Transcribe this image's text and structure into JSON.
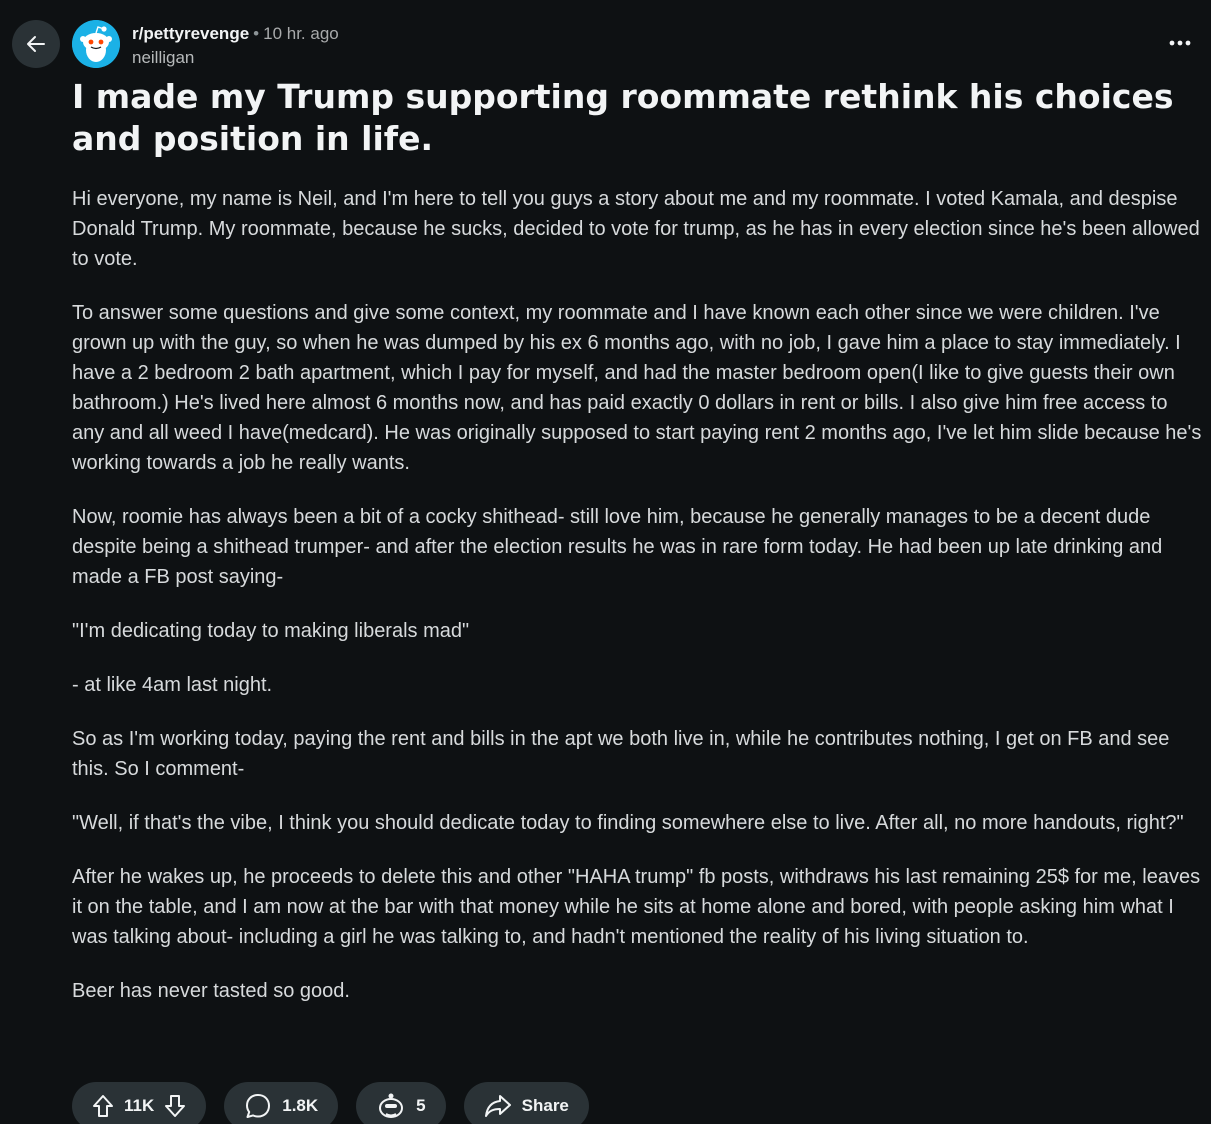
{
  "post": {
    "subreddit": "r/pettyrevenge",
    "separator": "•",
    "time": "10 hr. ago",
    "author": "neilligan",
    "title": "I made my Trump supporting roommate rethink his choices and position in life.",
    "paragraphs": [
      "Hi everyone, my name is Neil, and I'm here to tell you guys a story about me and my roommate. I voted Kamala, and despise Donald Trump. My roommate, because he sucks, decided to vote for trump, as he has in every election since he's been allowed to vote.",
      "To answer some questions and give some context, my roommate and I have known each other since we were children. I've grown up with the guy, so when he was dumped by his ex 6 months ago, with no job, I gave him a place to stay immediately. I have a 2 bedroom 2 bath apartment, which I pay for myself, and had the master bedroom open(I like to give guests their own bathroom.) He's lived here almost 6 months now, and has paid exactly 0 dollars in rent or bills. I also give him free access to any and all weed I have(medcard). He was originally supposed to start paying rent 2 months ago, I've let him slide because he's working towards a job he really wants.",
      "Now, roomie has always been a bit of a cocky shithead- still love him, because he generally manages to be a decent dude despite being a shithead trumper- and after the election results he was in rare form today. He had been up late drinking and made a FB post saying-",
      "\"I'm dedicating today to making liberals mad\"",
      "- at like 4am last night.",
      "So as I'm working today, paying the rent and bills in the apt we both live in, while he contributes nothing, I get on FB and see this. So I comment-",
      "\"Well, if that's the vibe, I think you should dedicate today to finding somewhere else to live. After all, no more handouts, right?\"",
      "After he wakes up, he proceeds to delete this and other \"HAHA trump\" fb posts, withdraws his last remaining 25$ for me, leaves it on the table, and I am now at the bar with that money while he sits at home alone and bored, with people asking him what I was talking about- including a girl he was talking to, and hadn't mentioned the reality of his living situation to.",
      "Beer has never tasted so good."
    ]
  },
  "actions": {
    "votes": "11K",
    "comments": "1.8K",
    "awards": "5",
    "share": "Share"
  },
  "icons": {
    "back": "arrow-left-icon",
    "avatar": "reddit-snoo-icon",
    "more": "more-horizontal-icon",
    "upvote": "upvote-arrow-icon",
    "downvote": "downvote-arrow-icon",
    "comment": "comment-bubble-icon",
    "award": "award-icon",
    "share": "share-arrow-icon"
  },
  "colors": {
    "background": "#0e1113",
    "pill": "#2a3236",
    "avatar": "#1bb1e6"
  }
}
